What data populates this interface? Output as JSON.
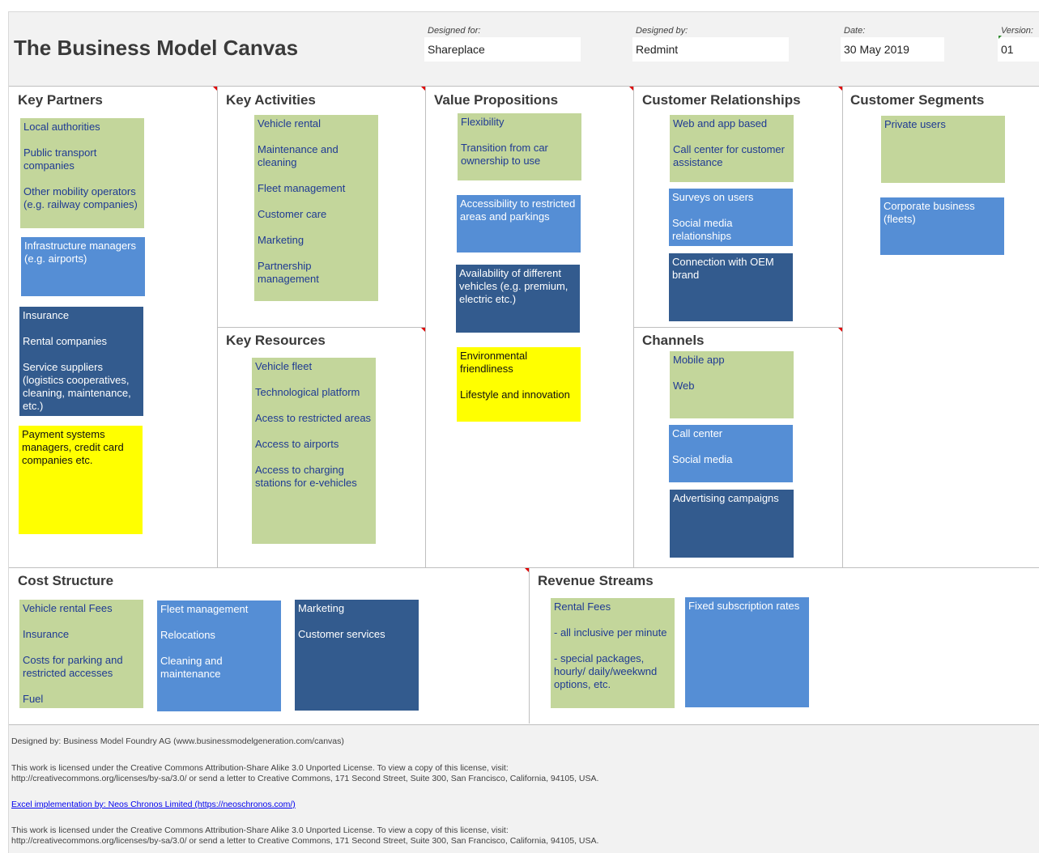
{
  "header": {
    "title": "The Business Model Canvas",
    "designed_for_label": "Designed for:",
    "designed_for_value": "Shareplace",
    "designed_by_label": "Designed by:",
    "designed_by_value": "Redmint",
    "date_label": "Date:",
    "date_value": "30 May 2019",
    "version_label": "Version:",
    "version_value": "01"
  },
  "sections": {
    "key_partners": {
      "title": "Key Partners",
      "notes": [
        {
          "color": "green",
          "items": [
            "Local authorities",
            "Public transport companies",
            "Other mobility operators (e.g. railway companies)"
          ]
        },
        {
          "color": "blue",
          "items": [
            "Infrastructure managers (e.g. airports)"
          ]
        },
        {
          "color": "dark",
          "items": [
            "Insurance",
            "Rental companies",
            "Service suppliers (logistics cooperatives, cleaning, maintenance, etc.)"
          ]
        },
        {
          "color": "yellow",
          "items": [
            "Payment systems managers, credit card companies etc."
          ]
        }
      ]
    },
    "key_activities": {
      "title": "Key Activities",
      "notes": [
        {
          "color": "green",
          "items": [
            "Vehicle rental",
            "Maintenance and cleaning",
            "Fleet management",
            "Customer care",
            "Marketing",
            "Partnership management"
          ]
        }
      ]
    },
    "key_resources": {
      "title": "Key Resources",
      "notes": [
        {
          "color": "green",
          "items": [
            "Vehicle fleet",
            "Technological platform",
            "Acess to restricted areas",
            "Access to airports",
            "Access to charging stations for e-vehicles"
          ]
        }
      ]
    },
    "value_propositions": {
      "title": "Value Propositions",
      "notes": [
        {
          "color": "green",
          "items": [
            "Flexibility",
            "Transition from car ownership to use"
          ]
        },
        {
          "color": "blue",
          "items": [
            "Accessibility to restricted areas and parkings"
          ]
        },
        {
          "color": "dark",
          "items": [
            "Availability of different vehicles (e.g. premium, electric etc.)"
          ]
        },
        {
          "color": "yellow",
          "items": [
            "Environmental friendliness",
            "Lifestyle and innovation"
          ]
        }
      ]
    },
    "customer_relationships": {
      "title": "Customer Relationships",
      "notes": [
        {
          "color": "green",
          "items": [
            "Web and app based",
            "Call center for customer assistance"
          ]
        },
        {
          "color": "blue",
          "items": [
            "Surveys on users",
            "Social media relationships"
          ]
        },
        {
          "color": "dark",
          "items": [
            "Connection with OEM brand"
          ]
        }
      ]
    },
    "channels": {
      "title": "Channels",
      "notes": [
        {
          "color": "green",
          "items": [
            "Mobile app",
            "Web"
          ]
        },
        {
          "color": "blue",
          "items": [
            "Call center",
            "Social media"
          ]
        },
        {
          "color": "dark",
          "items": [
            "Advertising campaigns"
          ]
        }
      ]
    },
    "customer_segments": {
      "title": "Customer Segments",
      "notes": [
        {
          "color": "green",
          "items": [
            "Private users"
          ]
        },
        {
          "color": "blue",
          "items": [
            "Corporate business (fleets)"
          ]
        }
      ]
    },
    "cost_structure": {
      "title": "Cost Structure",
      "notes": [
        {
          "color": "green",
          "items": [
            "Vehicle rental Fees",
            "Insurance",
            "Costs for parking and restricted accesses",
            "Fuel"
          ]
        },
        {
          "color": "blue",
          "items": [
            "Fleet management",
            "Relocations",
            "Cleaning and maintenance"
          ]
        },
        {
          "color": "dark",
          "items": [
            "Marketing",
            "Customer services"
          ]
        }
      ]
    },
    "revenue_streams": {
      "title": "Revenue Streams",
      "notes": [
        {
          "color": "green",
          "items": [
            "Rental Fees",
            "- all inclusive per minute",
            "- special packages, hourly/ daily/weekwnd options, etc."
          ]
        },
        {
          "color": "blue",
          "items": [
            "Fixed subscription rates"
          ]
        }
      ]
    }
  },
  "footer": {
    "credit": "Designed by: Business Model Foundry AG (www.businessmodelgeneration.com/canvas)",
    "license_1": "This work is licensed under the Creative Commons Attribution-Share Alike 3.0 Unported License. To view a copy of this license, visit:\nhttp://creativecommons.org/licenses/by-sa/3.0/ or send a letter to Creative Commons, 171 Second Street, Suite 300, San Francisco, California, 94105, USA.",
    "excel_link": "Excel implementation by: Neos Chronos Limited (https://neoschronos.com/)",
    "license_2": "This work is licensed under the Creative Commons Attribution-Share Alike 3.0 Unported License. To view a copy of this license, visit:\nhttp://creativecommons.org/licenses/by-sa/3.0/ or send a letter to Creative Commons, 171 Second Street, Suite 300, San Francisco, California, 94105, USA."
  },
  "colors": {
    "green_note": "#c3d69b",
    "blue_note": "#558ed5",
    "dark_note": "#335b8e",
    "yellow_note": "#ffff00",
    "comment_marker": "#e00000"
  }
}
